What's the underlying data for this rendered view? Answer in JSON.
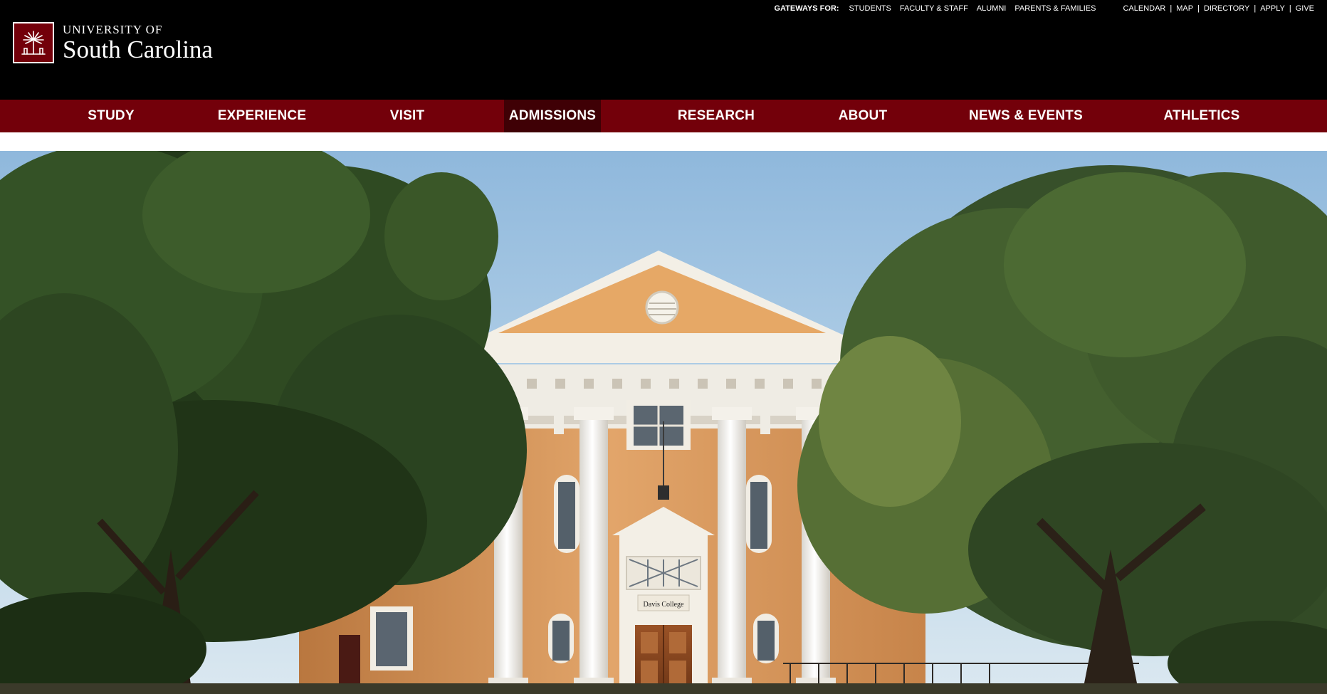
{
  "brand": {
    "name_line1": "UNIVERSITY OF",
    "name_line2": "South Carolina",
    "colors": {
      "garnet": "#73000a",
      "black": "#000000",
      "active_nav": "#3f0005"
    }
  },
  "utility": {
    "gateways_label": "GATEWAYS FOR:",
    "gateways": [
      "STUDENTS",
      "FACULTY & STAFF",
      "ALUMNI",
      "PARENTS & FAMILIES"
    ],
    "links": [
      "CALENDAR",
      "MAP",
      "DIRECTORY",
      "APPLY",
      "GIVE"
    ],
    "separator": "|"
  },
  "nav": {
    "items": [
      {
        "label": "STUDY"
      },
      {
        "label": "EXPERIENCE"
      },
      {
        "label": "VISIT"
      },
      {
        "label": "ADMISSIONS",
        "active": true
      },
      {
        "label": "RESEARCH"
      },
      {
        "label": "ABOUT"
      },
      {
        "label": "NEWS & EVENTS"
      },
      {
        "label": "ATHLETICS"
      }
    ]
  },
  "hero": {
    "sign_text": "Davis College",
    "icons": [
      "palmetto-logo-icon"
    ]
  }
}
